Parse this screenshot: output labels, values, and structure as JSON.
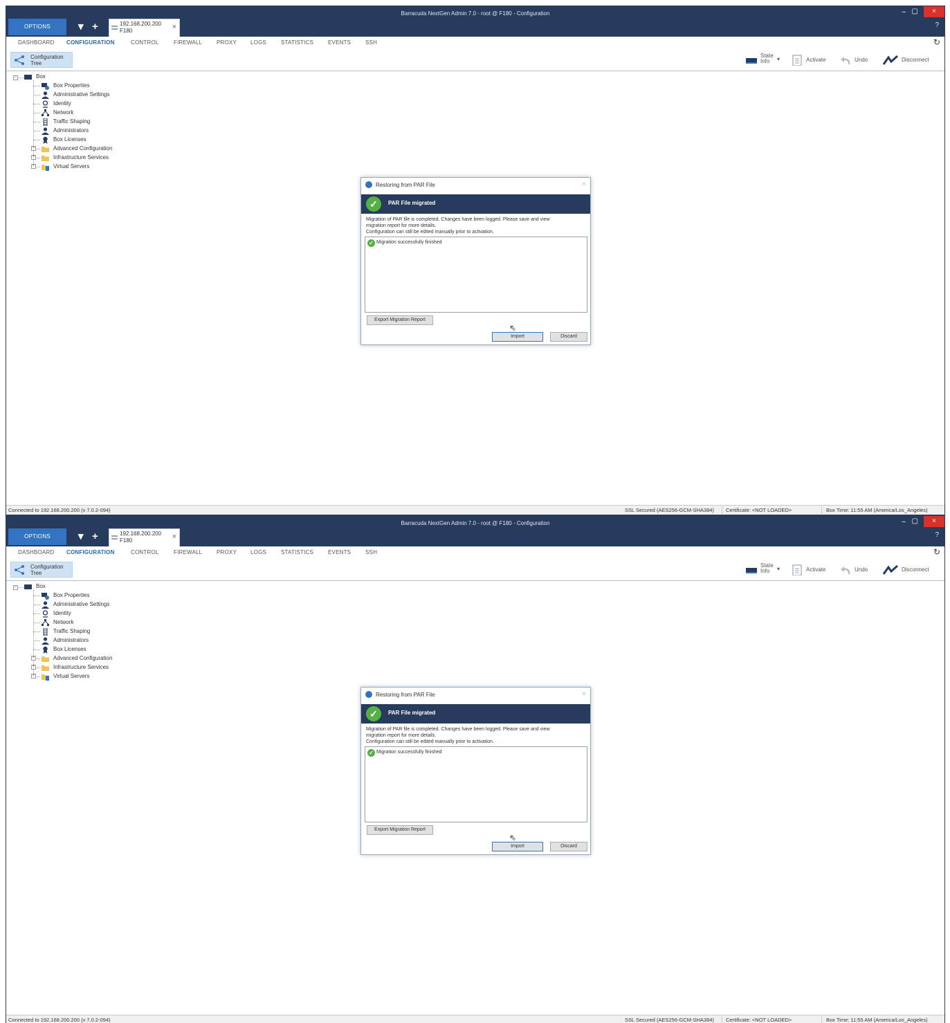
{
  "window": {
    "title": "Barracuda NextGen Admin 7.0 - root @ F180 - Configuration",
    "options_label": "OPTIONS",
    "minimize": "–",
    "restore": "▢",
    "close": "×",
    "help": "?"
  },
  "session_tab": {
    "ip": "192.168.200.200",
    "box": "F180",
    "close": "×"
  },
  "nav": {
    "items": [
      "DASHBOARD",
      "CONFIGURATION",
      "CONTROL",
      "FIREWALL",
      "PROXY",
      "LOGS",
      "STATISTICS",
      "EVENTS",
      "SSH"
    ],
    "active": "CONFIGURATION"
  },
  "toolbar": {
    "config_tree_line1": "Configuration",
    "config_tree_line2": "Tree",
    "state_info_line1": "State",
    "state_info_line2": "Info",
    "activate": "Activate",
    "undo": "Undo",
    "disconnect": "Disconnect"
  },
  "tree": {
    "root": "Box",
    "items": [
      "Box Properties",
      "Administrative Settings",
      "Identity",
      "Network",
      "Traffic Shaping",
      "Administrators",
      "Box Licenses",
      "Advanced Configuration",
      "Infrastructure Services",
      "Virtual Servers"
    ]
  },
  "dialog": {
    "title": "Restoring from PAR File",
    "banner": "PAR File migrated",
    "message_line1": "Migration of PAR file is completed. Changes have been logged. Please save and view",
    "message_line2": "migration report for more details.",
    "message_line3": "Configuration can still be edited manually prior to activation.",
    "log_entry": "Migration successfully finished",
    "export_button": "Export Migration Report",
    "import_button": "Import",
    "discard_button": "Discard"
  },
  "status": {
    "connected": "Connected to 192.168.200.200 (v 7.0.2-094)",
    "ssl": "SSL Secured (AES256-GCM-SHA384)",
    "certificate": "Certificate: <NOT LOADED>",
    "box_time": "Box Time: 11:55 AM (America/Los_Angeles)"
  },
  "colors": {
    "titlebar": "#273b5c",
    "accent": "#3274c2",
    "success": "#55b046",
    "close": "#d9322c"
  }
}
